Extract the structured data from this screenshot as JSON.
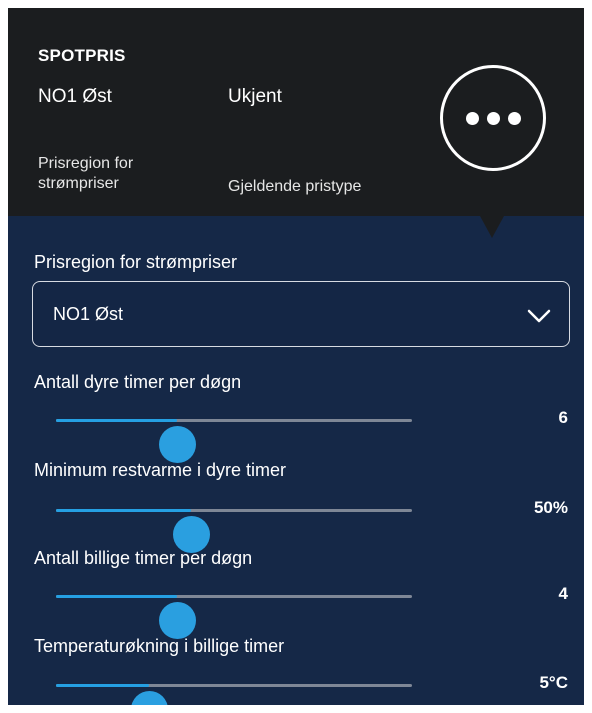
{
  "header": {
    "title": "SPOTPRIS",
    "region_value": "NO1 Øst",
    "type_value": "Ukjent",
    "region_caption": "Prisregion for strømpriser",
    "type_caption": "Gjeldende pristype",
    "more_icon": "more-horizontal-icon"
  },
  "region_select": {
    "label": "Prisregion for strømpriser",
    "value": "NO1 Øst",
    "icon": "chevron-down-icon"
  },
  "sliders": [
    {
      "label": "Antall dyre timer per døgn",
      "value_text": "6",
      "fraction": 0.34
    },
    {
      "label": "Minimum restvarme i dyre timer",
      "value_text": "50%",
      "fraction": 0.38
    },
    {
      "label": "Antall billige timer per døgn",
      "value_text": "4",
      "fraction": 0.34
    },
    {
      "label": "Temperaturøkning i billige timer",
      "value_text": "5°C",
      "fraction": 0.26
    }
  ],
  "colors": {
    "header_bg": "#1b1d1f",
    "panel_bg": "#152847",
    "accent": "#2a9fe0",
    "track": "#7e8796"
  }
}
